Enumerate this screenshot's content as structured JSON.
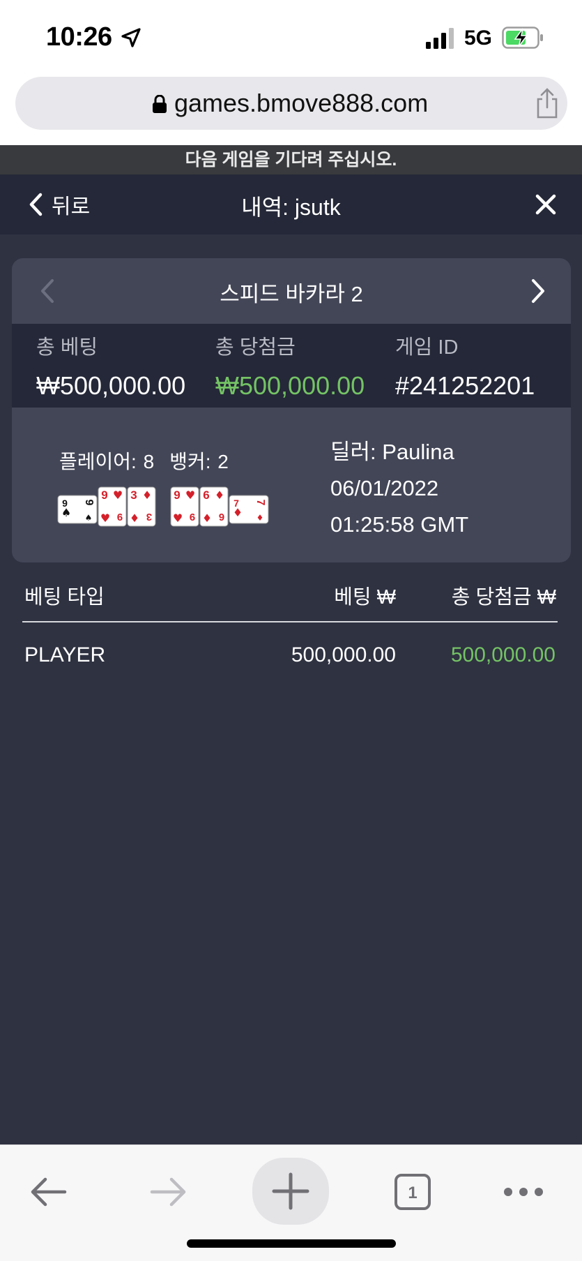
{
  "status": {
    "time": "10:26",
    "network": "5G"
  },
  "browser": {
    "url": "games.bmove888.com",
    "tab_count": "1"
  },
  "notice": "다음 게임을 기다려 주십시오.",
  "header": {
    "back_label": "뒤로",
    "title": "내역: jsutk"
  },
  "game": {
    "name": "스피드 바카라 2",
    "total_bet_label": "총 베팅",
    "total_bet_value": "₩500,000.00",
    "total_win_label": "총 당첨금",
    "total_win_value": "₩500,000.00",
    "game_id_label": "게임 ID",
    "game_id_value": "#241252201",
    "player_score": "플레이어: 8",
    "banker_score": "뱅커: 2",
    "dealer": "딜러: Paulina",
    "date": "06/01/2022",
    "time": "01:25:58 GMT",
    "player_cards": [
      {
        "rank": "9",
        "suit": "♠",
        "color": "#111111",
        "rotated": true
      },
      {
        "rank": "9",
        "suit": "♥",
        "color": "#d4202a",
        "rotated": false
      },
      {
        "rank": "3",
        "suit": "♦",
        "color": "#d4202a",
        "rotated": false
      }
    ],
    "banker_cards": [
      {
        "rank": "9",
        "suit": "♥",
        "color": "#d4202a",
        "rotated": false
      },
      {
        "rank": "6",
        "suit": "♦",
        "color": "#d4202a",
        "rotated": false
      },
      {
        "rank": "7",
        "suit": "♦",
        "color": "#d4202a",
        "rotated": true
      }
    ]
  },
  "bets": {
    "headers": {
      "type": "베팅 타입",
      "bet": "베팅 ₩",
      "win": "총 당첨금 ₩"
    },
    "rows": [
      {
        "type": "PLAYER",
        "bet": "500,000.00",
        "win": "500,000.00"
      }
    ]
  },
  "colors": {
    "win": "#74c365",
    "background": "#2f3241",
    "header": "#252838",
    "card": "#434657"
  }
}
